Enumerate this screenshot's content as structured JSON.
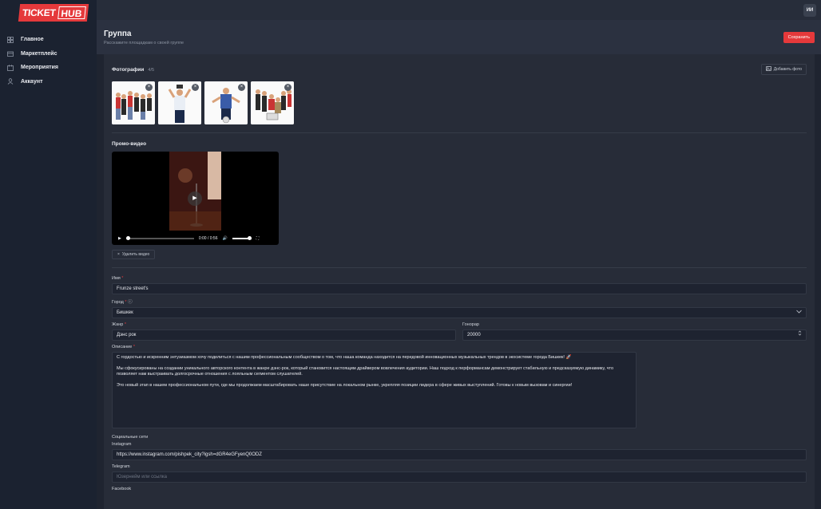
{
  "app": {
    "logo_ticket": "TICKET",
    "logo_hub": "HUB",
    "avatar_initials": "ИИ"
  },
  "sidebar": {
    "items": [
      {
        "label": "Главное",
        "icon": "home-icon"
      },
      {
        "label": "Маркетплейс",
        "icon": "store-icon"
      },
      {
        "label": "Мероприятия",
        "icon": "calendar-icon"
      },
      {
        "label": "Аккаунт",
        "icon": "user-icon"
      }
    ]
  },
  "header": {
    "title": "Группа",
    "subtitle": "Расскажите площадкам о своей группе",
    "save_label": "Сохранить"
  },
  "photos": {
    "title": "Фотографии",
    "count": "4/5",
    "add_label": "Добавить фото"
  },
  "video": {
    "title": "Промо-видео",
    "time": "0:00 / 0:56",
    "delete_label": "Удалить видео"
  },
  "form": {
    "name_label": "Имя",
    "name_value": "Frunze street's",
    "city_label": "Город",
    "city_value": "Бишкек",
    "genre_label": "Жанр",
    "genre_value": "Дэнс рок",
    "fee_label": "Гонорар",
    "fee_value": "20000",
    "description_label": "Описание",
    "description_p1": "С гордостью и искренним энтузиазмом хочу поделиться с нашим профессиональным сообществом о том, что наша команда находится на передовой инновационных музыкальных трендов в экосистеме города Бишкек! 🚀",
    "description_p2": "Мы сфокусированы на создании уникального авторского контента в жанре дэнс-рок, который становится настоящим драйвером вовлечения аудитории. Наш подход к перформансам демонстрирует стабильную и предсказуемую динамику, что позволяет нам выстраивать долгосрочные отношения с лояльным сегментом слушателей.",
    "description_p3": "Это новый этап в нашем профессиональном пути, где мы продолжаем масштабировать наше присутствие на локальном рынке, укрепляя позиции лидера в сфере живых выступлений. Готовы к новым вызовам и синергии!",
    "social_title": "Социальные сети",
    "instagram_label": "Instagram",
    "instagram_value": "https://www.instagram.com/pishpek_city?igsh=dGR4eGFyenQ0ODZ",
    "telegram_label": "Telegram",
    "telegram_placeholder": "Юзернейм или ссылка",
    "facebook_label": "Facebook"
  },
  "colors": {
    "accent": "#e5393b",
    "background": "#1f2430",
    "panel": "#272c38"
  }
}
